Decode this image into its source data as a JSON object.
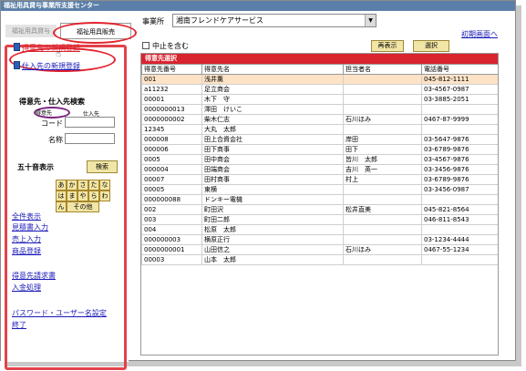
{
  "window": {
    "title": "福祉用具貸与事業所支援センター"
  },
  "tabs": [
    {
      "label": "福祉用具貸与",
      "active": false
    },
    {
      "label": "福祉用具販売",
      "active": true
    }
  ],
  "sidebar": {
    "register_customer": "得意先の新規登録",
    "register_supplier": "仕入先の新規登録",
    "search_heading": "得意先・仕入先検索",
    "radio_customer": "得意先",
    "radio_supplier": "仕入先",
    "code_label": "コード",
    "name_label": "名称",
    "kana_heading": "五十音表示",
    "search_button": "検索",
    "kana": [
      "あ",
      "か",
      "さ",
      "た",
      "な",
      "は",
      "ま",
      "や",
      "ら",
      "わ",
      "ん",
      "その他"
    ],
    "links": [
      "全件表示",
      "見積書入力",
      "売上入力",
      "商品登録",
      "得意先請求書",
      "入金処理",
      "パスワード・ユーザー名設定",
      "終了"
    ]
  },
  "toolbar": {
    "office_label": "事業所",
    "office_value": "湘南フレンドケアサービス",
    "initial_screen_link": "初期画面へ",
    "include_stopped_label": "中止を含む",
    "redisplay_button": "再表示",
    "select_button": "選択"
  },
  "table": {
    "caption": "得意先選択",
    "headers": [
      "得意先番号",
      "得意先名",
      "担当者名",
      "電話番号"
    ],
    "rows": [
      [
        "001",
        "浅井薫",
        "",
        "045-812-1111"
      ],
      [
        "a11232",
        "足立商会",
        "",
        "03-4567-0987"
      ],
      [
        "00001",
        "木下　守",
        "",
        "03-3885-2051"
      ],
      [
        "0000000013",
        "澤田　けいこ",
        "",
        ""
      ],
      [
        "0000000002",
        "柴木仁志",
        "石川ほみ",
        "0467-87-9999"
      ],
      [
        "12345",
        "大丸　太郎",
        "",
        ""
      ],
      [
        "000008",
        "田上合資会社",
        "岸田",
        "03-5647-9876"
      ],
      [
        "000006",
        "田下商事",
        "田下",
        "03-6789-9876"
      ],
      [
        "0005",
        "田中商会",
        "皆川　太郎",
        "03-4567-9876"
      ],
      [
        "000004",
        "田端商会",
        "吉川　英一",
        "03-3456-9876"
      ],
      [
        "00007",
        "田村商事",
        "村上",
        "03-6789-9876"
      ],
      [
        "00005",
        "東横",
        "",
        "03-3456-0987"
      ],
      [
        "000000088",
        "ドンキー電機",
        "",
        ""
      ],
      [
        "002",
        "町田沢",
        "松井直美",
        "045-821-8564"
      ],
      [
        "003",
        "町田二郎",
        "",
        "046-811-8543"
      ],
      [
        "004",
        "松原　太郎",
        "",
        ""
      ],
      [
        "000000003",
        "横原正行",
        "",
        "03-1234-4444"
      ],
      [
        "0000000001",
        "山田信之",
        "石川ほみ",
        "0467-55-1234"
      ],
      [
        "00003",
        "山本　太郎",
        "",
        ""
      ]
    ]
  }
}
